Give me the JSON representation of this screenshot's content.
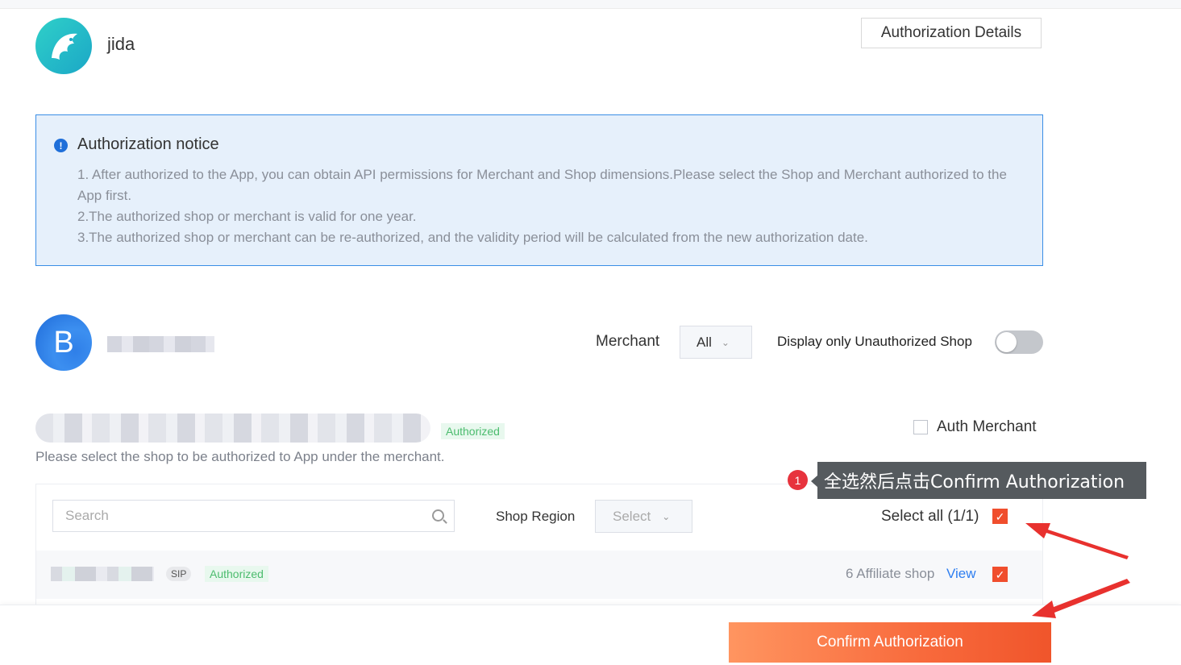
{
  "app": {
    "name": "jida",
    "details_button": "Authorization Details"
  },
  "notice": {
    "title": "Authorization notice",
    "lines": [
      "1. After authorized to the App, you can obtain API permissions for Merchant and Shop dimensions.Please select the Shop and Merchant authorized to the App first.",
      "2.The authorized shop or merchant is valid for one year.",
      "3.The authorized shop or merchant can be re-authorized, and the validity period will be calculated from the new authorization date."
    ]
  },
  "merchant": {
    "avatar_letter": "B",
    "filter_label": "Merchant",
    "filter_value": "All",
    "display_only_label": "Display only Unauthorized Shop",
    "display_only_enabled": false
  },
  "shop_group": {
    "status_tag": "Authorized",
    "auth_merchant_label": "Auth Merchant",
    "auth_merchant_checked": false,
    "hint": "Please select the shop to be authorized to App under the merchant."
  },
  "filters": {
    "search_placeholder": "Search",
    "region_label": "Shop Region",
    "region_placeholder": "Select",
    "select_all_label": "Select all (1/1)",
    "select_all_checked": true
  },
  "shops": [
    {
      "region_tag": "SIP",
      "status_tag": "Authorized",
      "affiliate_text": "6 Affiliate shop",
      "view_label": "View",
      "checked": true
    }
  ],
  "annotation": {
    "badge": "1",
    "tooltip": "全选然后点击Confirm Authorization",
    "arrow_color": "#e8312e"
  },
  "footer": {
    "confirm_button": "Confirm Authorization"
  },
  "colors": {
    "accent": "#f04e2d",
    "link": "#2e7ef0",
    "success": "#4cbc6e",
    "notice_border": "#3a8ee6"
  }
}
